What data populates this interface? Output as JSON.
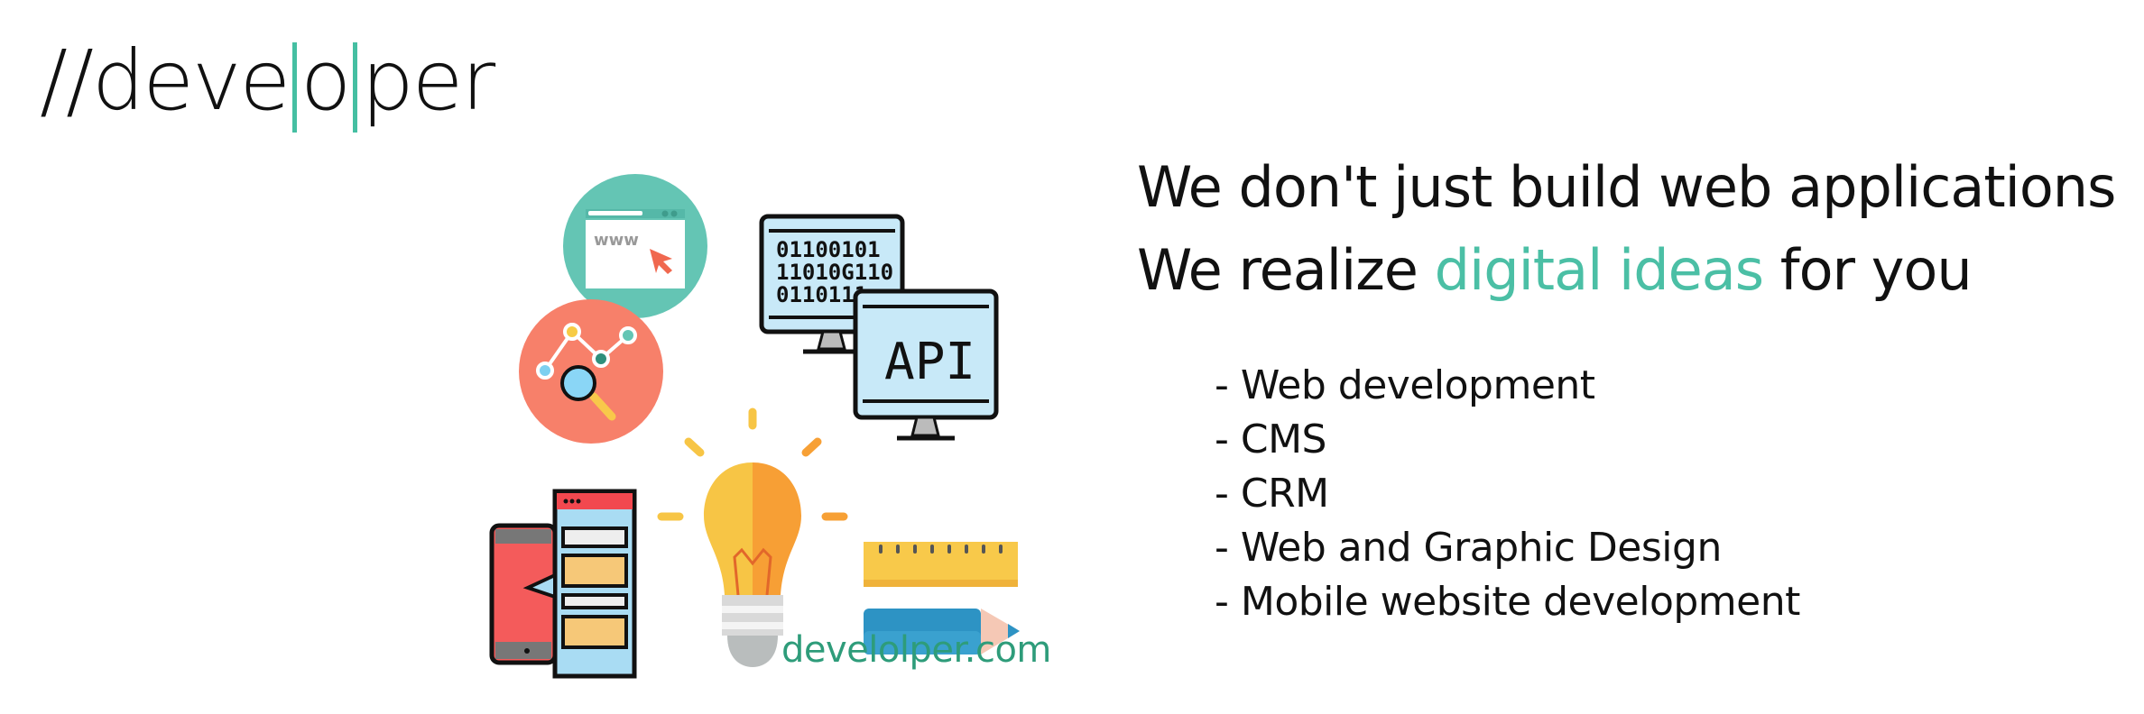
{
  "logo": {
    "part1": "//deve",
    "part2": "o",
    "part3": "per"
  },
  "headline": {
    "line1": "We don't just build web applications",
    "line2_prefix": "We realize ",
    "line2_accent": "digital ideas",
    "line2_suffix": " for you"
  },
  "services": [
    "- Web development",
    "- CMS",
    "- CRM",
    "- Web and Graphic Design",
    "- Mobile website development"
  ],
  "illustration": {
    "browser_text": "www",
    "binary_lines": [
      "01100101",
      "11010G110",
      "0110111"
    ],
    "api_label": "API"
  },
  "website": "develolper.com",
  "colors": {
    "accent": "#4bbfa5",
    "site_text": "#2e9c7a",
    "teal_circle": "#64c5b4",
    "coral_circle": "#f7806a"
  }
}
